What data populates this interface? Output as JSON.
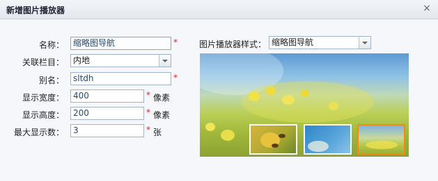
{
  "dialog": {
    "title": "新增图片播放器",
    "close_symbol": "×"
  },
  "form": {
    "name_label": "名称：",
    "name_value": "缩略图导航",
    "column_label": "关联栏目：",
    "column_value": "内地",
    "alias_label": "别名：",
    "alias_value": "sltdh",
    "width_label": "显示宽度：",
    "width_value": "400",
    "width_unit": "像素",
    "height_label": "显示高度：",
    "height_value": "200",
    "height_unit": "像素",
    "max_label": "最大显示数：",
    "max_value": "3",
    "max_unit": "张",
    "required_mark": "*"
  },
  "style_select": {
    "label": "图片播放器样式：",
    "value": "缩略图导航"
  },
  "preview": {
    "thumbnails": [
      "bees-on-flower",
      "dandelion-on-blue",
      "yellow-field"
    ],
    "active_index": 2,
    "active_border_color": "#f08a18"
  }
}
